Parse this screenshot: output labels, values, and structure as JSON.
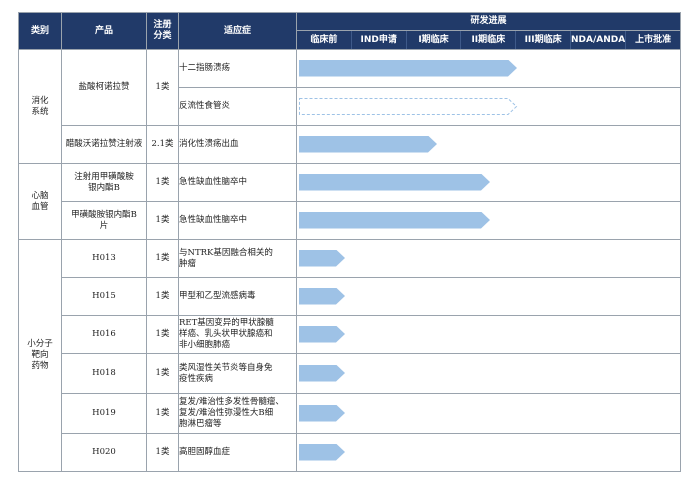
{
  "header": {
    "category": "类别",
    "product": "产品",
    "registration": "注册\n分类",
    "indication": "适应症",
    "progress": "研发进展",
    "stages": [
      "临床前",
      "IND申请",
      "I期临床",
      "II期临床",
      "III期临床",
      "NDA/ANDA",
      "上市批准"
    ]
  },
  "colors": {
    "header_bg": "#213a69",
    "bar_fill": "#9ec2e6",
    "dashed_outline": "#9ec2e6",
    "grid": "#9aa3ad"
  },
  "groups": [
    {
      "category": "消化\n系统",
      "products": [
        {
          "name": "盐酸柯诺拉赞",
          "registration": "1类",
          "indications": [
            {
              "text": "十二指肠溃疡",
              "progress": 0.57,
              "style": "solid"
            },
            {
              "text": "反流性食管炎",
              "progress": 0.57,
              "style": "dashed"
            }
          ]
        },
        {
          "name": "醋酸沃诺拉赞注射液",
          "registration": "2.1类",
          "indications": [
            {
              "text": "消化性溃疡出血",
              "progress": 0.36,
              "style": "solid"
            }
          ]
        }
      ]
    },
    {
      "category": "心脑\n血管",
      "products": [
        {
          "name": "注射用甲磺酸胺\n银内酯B",
          "registration": "1类",
          "indications": [
            {
              "text": "急性缺血性脑卒中",
              "progress": 0.5,
              "style": "solid"
            }
          ]
        },
        {
          "name": "甲磺酸胺银内酯B\n片",
          "registration": "1类",
          "indications": [
            {
              "text": "急性缺血性脑卒中",
              "progress": 0.5,
              "style": "solid"
            }
          ]
        }
      ]
    },
    {
      "category": "小分子\n靶向\n药物",
      "products": [
        {
          "name": "H013",
          "registration": "1类",
          "indications": [
            {
              "text": "与NTRK基因融合相关的\n肿瘤",
              "progress": 0.12,
              "style": "solid"
            }
          ]
        },
        {
          "name": "H015",
          "registration": "1类",
          "indications": [
            {
              "text": "甲型和乙型流感病毒",
              "progress": 0.12,
              "style": "solid"
            }
          ]
        },
        {
          "name": "H016",
          "registration": "1类",
          "indications": [
            {
              "text": "RET基因变异的甲状腺髓\n样癌、乳头状甲状腺癌和\n非小细胞肺癌",
              "progress": 0.12,
              "style": "solid"
            }
          ]
        },
        {
          "name": "H018",
          "registration": "1类",
          "indications": [
            {
              "text": "类风湿性关节炎等自身免\n疫性疾病",
              "progress": 0.12,
              "style": "solid"
            }
          ]
        },
        {
          "name": "H019",
          "registration": "1类",
          "indications": [
            {
              "text": "复发/难治性多发性骨髓瘤、\n复发/难治性弥漫性大B细\n胞淋巴瘤等",
              "progress": 0.12,
              "style": "solid"
            }
          ]
        },
        {
          "name": "H020",
          "registration": "1类",
          "indications": [
            {
              "text": "高胆固醇血症",
              "progress": 0.12,
              "style": "solid"
            }
          ]
        }
      ]
    }
  ]
}
